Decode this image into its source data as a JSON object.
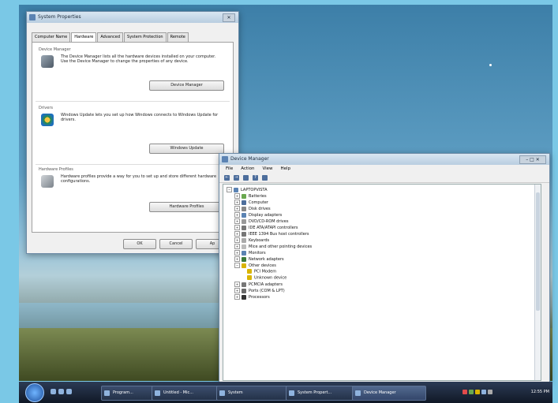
{
  "sysprops": {
    "title": "System Properties",
    "tabs": [
      "Computer Name",
      "Hardware",
      "Advanced",
      "System Protection",
      "Remote"
    ],
    "device_manager": {
      "title": "Device Manager",
      "text": "The Device Manager lists all the hardware devices installed on your computer. Use the Device Manager to change the properties of any device.",
      "button": "Device Manager"
    },
    "drivers": {
      "title": "Drivers",
      "text": "Windows Update lets you set up how Windows connects to Windows Update for drivers.",
      "button": "Windows Update"
    },
    "hardware_profiles": {
      "title": "Hardware Profiles",
      "text": "Hardware profiles provide a way for you to set up and store different hardware configurations.",
      "button": "Hardware Profiles"
    },
    "ok": "OK",
    "cancel": "Cancel",
    "apply": "Ap"
  },
  "devmgr": {
    "title": "Device Manager",
    "menu": [
      "File",
      "Action",
      "View",
      "Help"
    ],
    "root": "LAPTOPVISTA",
    "items": [
      "Batteries",
      "Computer",
      "Disk drives",
      "Display adapters",
      "DVD/CD-ROM drives",
      "IDE ATA/ATAPI controllers",
      "IEEE 1394 Bus host controllers",
      "Keyboards",
      "Mice and other pointing devices",
      "Monitors",
      "Network adapters",
      "Other devices",
      "PCI Modem",
      "Unknown device",
      "PCMCIA adapters",
      "Ports (COM & LPT)",
      "Processors"
    ]
  },
  "taskbar": {
    "buttons": [
      "Program...",
      "Untitled - Mic...",
      "System",
      "System Propert...",
      "Device Manager"
    ],
    "clock": "12:55 PM"
  },
  "colors": {
    "accent": "#5b83b3",
    "desktop": "#7ac8e6"
  }
}
